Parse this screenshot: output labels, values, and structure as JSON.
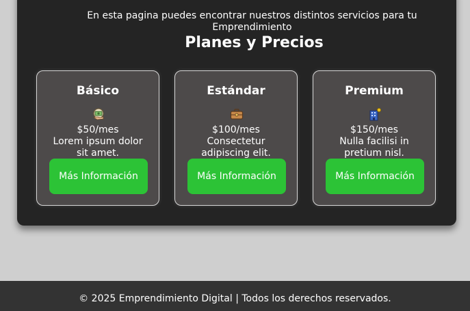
{
  "intro_text": "En esta pagina puedes encontrar nuestros distintos servicios para tu Emprendimiento",
  "section_title": "Planes y Precios",
  "plans": [
    {
      "title": "Básico",
      "icon": "money-hand-icon",
      "price": "$50/mes",
      "description": "Lorem ipsum dolor sit amet.",
      "button_label": "Más Información"
    },
    {
      "title": "Estándar",
      "icon": "briefcase-icon",
      "price": "$100/mes",
      "description": "Consectetur adipiscing elit.",
      "button_label": "Más Información"
    },
    {
      "title": "Premium",
      "icon": "building-icon",
      "price": "$150/mes",
      "description": "Nulla facilisi in pretium nisl.",
      "button_label": "Más Información"
    }
  ],
  "footer_text": "© 2025 Emprendimiento Digital | Todos los derechos reservados.",
  "colors": {
    "page_background": "#cfcfcf",
    "panel_background": "#242424",
    "card_background": "#4d4a4a",
    "button_green": "#2cc336",
    "footer_background": "#333333",
    "text": "#ffffff"
  }
}
